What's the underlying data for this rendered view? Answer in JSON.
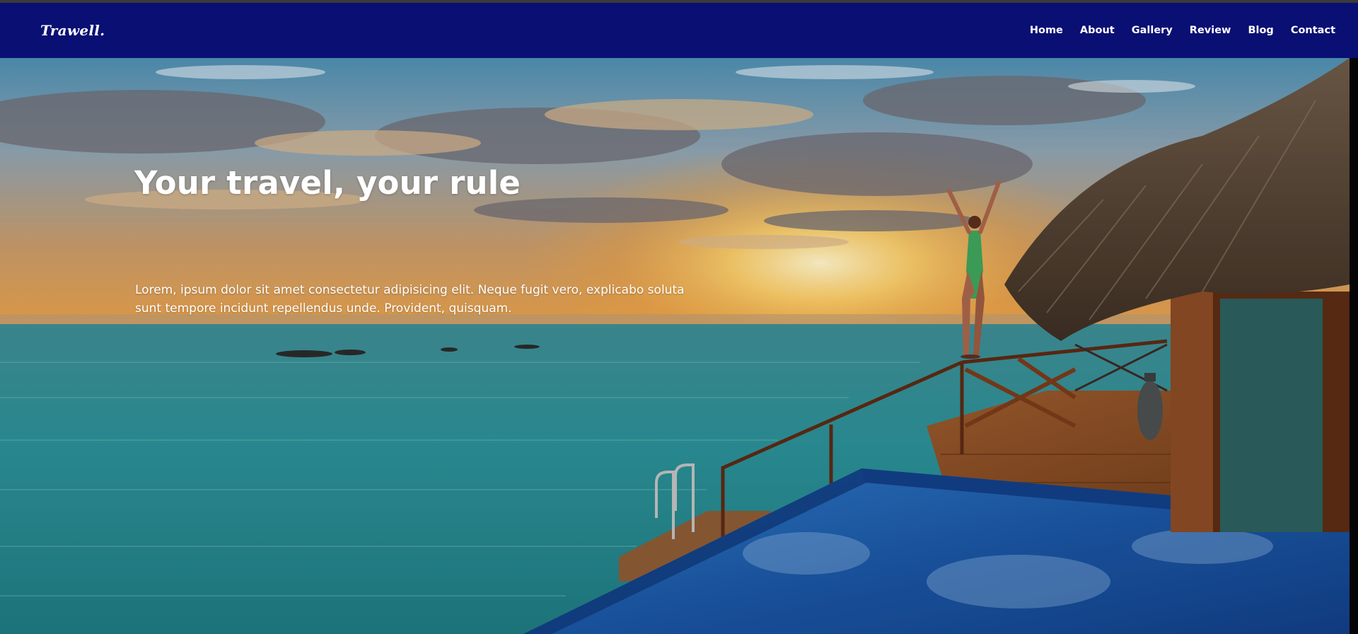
{
  "brand": {
    "logo": "Trawell."
  },
  "nav": {
    "links": [
      "Home",
      "About",
      "Gallery",
      "Review",
      "Blog",
      "Contact"
    ]
  },
  "hero": {
    "title": "Your travel, your rule",
    "description": "Lorem, ipsum dolor sit amet consectetur adipisicing elit. Neque fugit vero, explicabo soluta sunt tempore incidunt repellendus unde. Provident, quisquam.",
    "background": "sunset-overwater-villa-photo"
  },
  "colors": {
    "navbar": "#0a0f74",
    "text": "#ffffff",
    "sea": "#2a8c95",
    "pool": "#1c5fa8"
  }
}
